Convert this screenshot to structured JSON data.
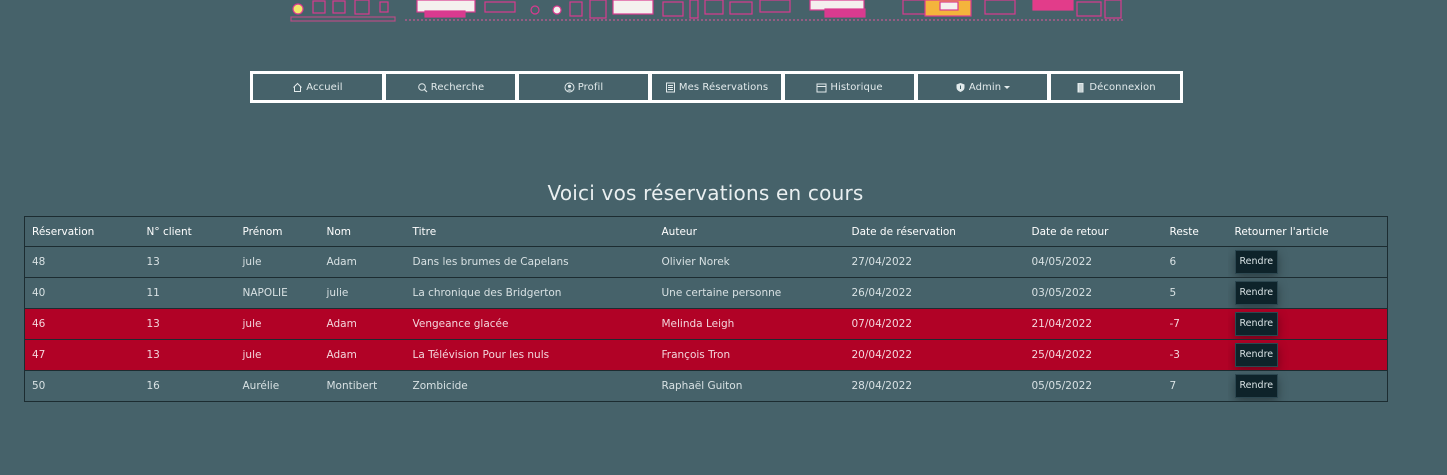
{
  "nav": {
    "items": [
      {
        "label": "Accueil",
        "icon": "house-icon"
      },
      {
        "label": "Recherche",
        "icon": "search-icon"
      },
      {
        "label": "Profil",
        "icon": "user-circle-icon"
      },
      {
        "label": "Mes Réservations",
        "icon": "list-icon"
      },
      {
        "label": "Historique",
        "icon": "calendar-icon"
      },
      {
        "label": "Admin",
        "icon": "shield-icon"
      },
      {
        "label": "Déconnexion",
        "icon": "door-icon"
      }
    ]
  },
  "page": {
    "title": "Voici vos réservations en cours"
  },
  "table": {
    "headers": [
      "Réservation",
      "N° client",
      "Prénom",
      "Nom",
      "Titre",
      "Auteur",
      "Date de réservation",
      "Date de retour",
      "Reste",
      "Retourner l'article"
    ],
    "button_label": "Rendre",
    "rows": [
      {
        "id": "48",
        "client": "13",
        "prenom": "jule",
        "nom": "Adam",
        "titre": "Dans les brumes de Capelans",
        "auteur": "Olivier Norek",
        "date_resa": "27/04/2022",
        "date_retour": "04/05/2022",
        "reste": "6",
        "late": false
      },
      {
        "id": "40",
        "client": "11",
        "prenom": "NAPOLIE",
        "nom": "julie",
        "titre": "La chronique des Bridgerton",
        "auteur": "Une certaine personne",
        "date_resa": "26/04/2022",
        "date_retour": "03/05/2022",
        "reste": "5",
        "late": false
      },
      {
        "id": "46",
        "client": "13",
        "prenom": "jule",
        "nom": "Adam",
        "titre": "Vengeance glacée",
        "auteur": "Melinda Leigh",
        "date_resa": "07/04/2022",
        "date_retour": "21/04/2022",
        "reste": "-7",
        "late": true
      },
      {
        "id": "47",
        "client": "13",
        "prenom": "jule",
        "nom": "Adam",
        "titre": "La Télévision Pour les nuls",
        "auteur": "François Tron",
        "date_resa": "20/04/2022",
        "date_retour": "25/04/2022",
        "reste": "-3",
        "late": true
      },
      {
        "id": "50",
        "client": "16",
        "prenom": "Aurélie",
        "nom": "Montibert",
        "titre": "Zombicide",
        "auteur": "Raphaël Guiton",
        "date_resa": "28/04/2022",
        "date_retour": "05/05/2022",
        "reste": "7",
        "late": false
      }
    ]
  },
  "colors": {
    "background": "#46626a",
    "late_row": "#b10226",
    "button": "#0e232a"
  }
}
